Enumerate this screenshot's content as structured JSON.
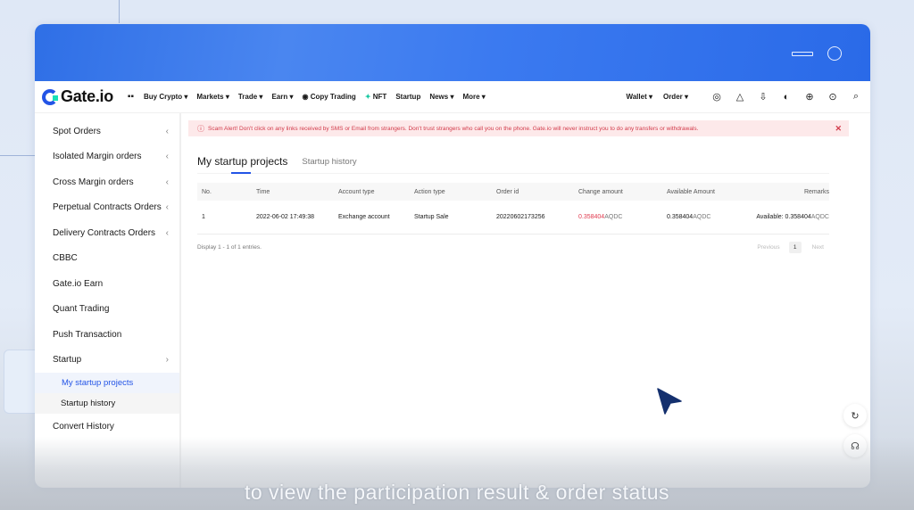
{
  "navbar": {
    "logo": "Gate.io",
    "items": [
      "Buy Crypto ▾",
      "Markets ▾",
      "Trade ▾",
      "Earn ▾",
      "Copy Trading",
      "NFT",
      "Startup",
      "News ▾",
      "More ▾"
    ],
    "right_items": [
      "Wallet ▾",
      "Order ▾"
    ]
  },
  "sidebar": {
    "items": [
      {
        "label": "Spot Orders",
        "chev": "‹"
      },
      {
        "label": "Isolated Margin orders",
        "chev": "‹"
      },
      {
        "label": "Cross Margin orders",
        "chev": "‹"
      },
      {
        "label": "Perpetual Contracts Orders",
        "chev": "‹"
      },
      {
        "label": "Delivery Contracts Orders",
        "chev": "‹"
      },
      {
        "label": "CBBC",
        "chev": ""
      },
      {
        "label": "Gate.io Earn",
        "chev": ""
      },
      {
        "label": "Quant Trading",
        "chev": ""
      },
      {
        "label": "Push Transaction",
        "chev": ""
      },
      {
        "label": "Startup",
        "chev": "›"
      }
    ],
    "sub_items": [
      "My startup projects",
      "Startup history"
    ],
    "last_item": "Convert History"
  },
  "alert": {
    "text": "Scam Alert! Don't click on any links received by SMS or Email from strangers. Don't trust strangers who call you on the phone. Gate.io will never instruct you to do any transfers or withdrawals."
  },
  "tabs": [
    "My startup projects",
    "Startup history"
  ],
  "table": {
    "headers": [
      "No.",
      "Time",
      "Account type",
      "Action type",
      "Order id",
      "Change amount",
      "Available Amount",
      "Remarks"
    ],
    "rows": [
      {
        "no": "1",
        "time": "2022-06-02 17:49:38",
        "account_type": "Exchange account",
        "action_type": "Startup Sale",
        "order_id": "20220602173256",
        "change_value": "0.358404",
        "change_unit": "AQDC",
        "available_value": "0.358404",
        "available_unit": "AQDC",
        "remarks_prefix": "Available: 0.358404",
        "remarks_unit": "AQDC"
      }
    ]
  },
  "pagination": {
    "display": "Display 1 - 1 of 1 entries.",
    "previous": "Previous",
    "page": "1",
    "next": "Next"
  },
  "caption": "to view the participation result & order status",
  "colors": {
    "brand_blue": "#2354e6",
    "alert_red": "#d23a4a",
    "amount_red": "#e03a4e",
    "header_blue": "#2f6fe6"
  }
}
